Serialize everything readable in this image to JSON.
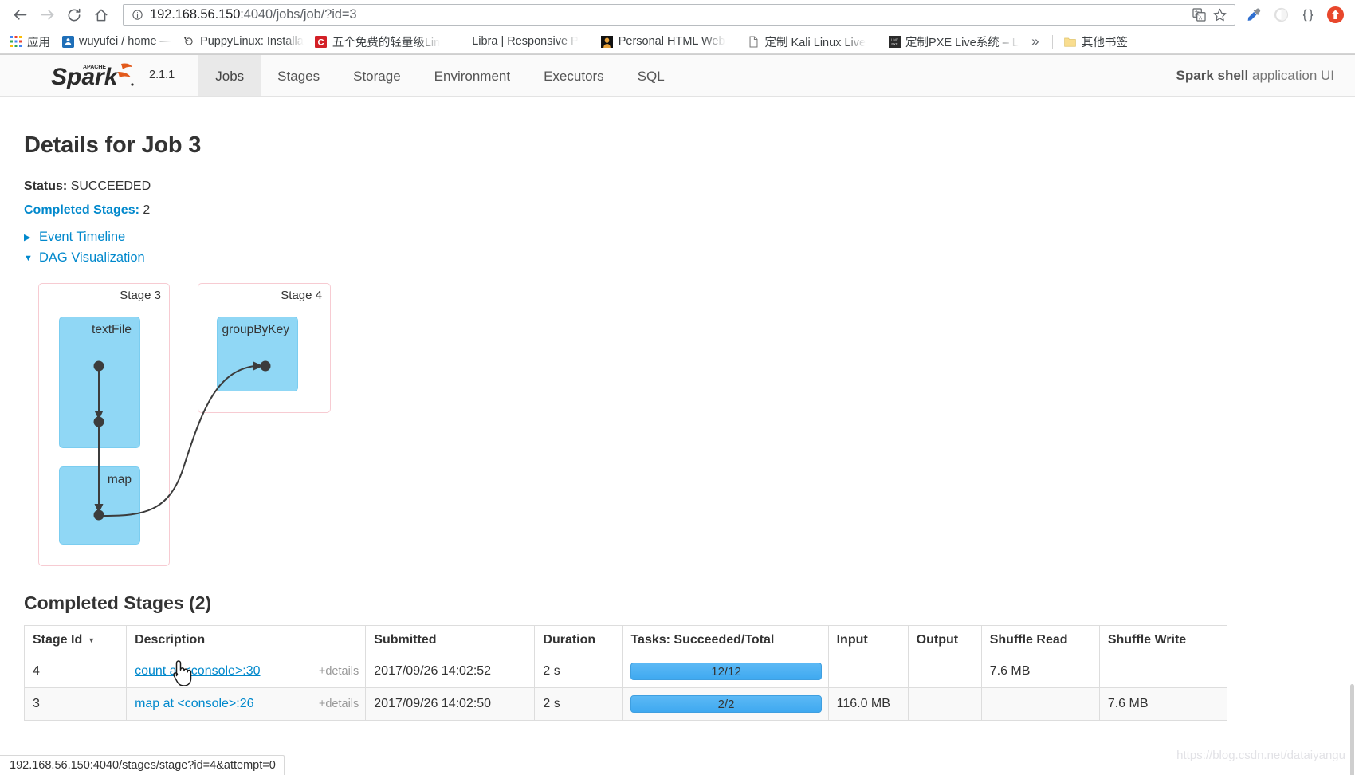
{
  "browser": {
    "nav": {
      "back_icon": "back-arrow-icon",
      "forward_icon": "forward-arrow-icon",
      "reload_icon": "reload-icon",
      "home_icon": "home-icon"
    },
    "omnibox": {
      "info_icon": "page-info-icon",
      "url_main": "192.168.56.150",
      "url_rest": ":4040/jobs/job/?id=3",
      "full_url": "192.168.56.150:4040/jobs/job/?id=3",
      "translate_icon": "translate-icon",
      "bookmark_icon": "star-icon"
    },
    "extensions": [
      {
        "name": "eyedropper-extension-icon",
        "glyph": "eyedropper"
      },
      {
        "name": "circle-extension-icon",
        "glyph": "circle"
      },
      {
        "name": "braces-extension-icon",
        "glyph": "{}"
      },
      {
        "name": "orange-arrow-extension-icon",
        "glyph": "arrow-up"
      }
    ],
    "bookmarks": {
      "apps_label": "应用",
      "items": [
        {
          "label": "wuyufei / home —",
          "icon": "github-favicon"
        },
        {
          "label": "PuppyLinux: Installa",
          "icon": "puppy-favicon"
        },
        {
          "label": "五个免费的轻量级Lin",
          "icon": "c-favicon"
        },
        {
          "label": "Libra | Responsive P",
          "icon": "generic-favicon"
        },
        {
          "label": "Personal HTML Web",
          "icon": "person-favicon"
        },
        {
          "label": "定制 Kali Linux Live",
          "icon": "doc-favicon"
        },
        {
          "label": "定制PXE Live系统 – L",
          "icon": "pxe-favicon"
        }
      ],
      "overflow_label": "»",
      "other_bookmarks_label": "其他书签",
      "other_bookmarks_icon": "folder-icon"
    }
  },
  "spark": {
    "logo_text": "Spark",
    "logo_superscript": "APACHE",
    "version": "2.1.1",
    "tabs": [
      {
        "label": "Jobs",
        "active": true
      },
      {
        "label": "Stages",
        "active": false
      },
      {
        "label": "Storage",
        "active": false
      },
      {
        "label": "Environment",
        "active": false
      },
      {
        "label": "Executors",
        "active": false
      },
      {
        "label": "SQL",
        "active": false
      }
    ],
    "app_title_bold": "Spark shell",
    "app_title_rest": " application UI"
  },
  "job": {
    "title": "Details for Job 3",
    "status_label": "Status:",
    "status_value": "SUCCEEDED",
    "completed_stages_label": "Completed Stages:",
    "completed_stages_value": "2",
    "event_timeline_label": "Event Timeline",
    "event_timeline_arrow": "▶",
    "dag_label": "DAG Visualization",
    "dag_arrow": "▼"
  },
  "dag": {
    "stages": [
      {
        "label": "Stage 3",
        "nodes": [
          {
            "label": "textFile"
          },
          {
            "label": "map"
          }
        ]
      },
      {
        "label": "Stage 4",
        "nodes": [
          {
            "label": "groupByKey"
          }
        ]
      }
    ],
    "colors": {
      "stage_border": "#f7cbd2",
      "node_fill": "#90d7f5",
      "edge": "#333333"
    }
  },
  "stages_table": {
    "heading": "Completed Stages (2)",
    "columns": [
      "Stage Id",
      "Description",
      "Submitted",
      "Duration",
      "Tasks: Succeeded/Total",
      "Input",
      "Output",
      "Shuffle Read",
      "Shuffle Write"
    ],
    "sort_column_index": 0,
    "sort_caret": "▼",
    "details_label": "+details",
    "rows": [
      {
        "stage_id": "4",
        "description": "count at <console>:30",
        "details": "+details",
        "submitted": "2017/09/26 14:02:52",
        "duration": "2 s",
        "tasks": "12/12",
        "tasks_pct": 100,
        "input": "",
        "output": "",
        "shuffle_read": "7.6 MB",
        "shuffle_write": "",
        "hovered": true
      },
      {
        "stage_id": "3",
        "description": "map at <console>:26",
        "details": "+details",
        "submitted": "2017/09/26 14:02:50",
        "duration": "2 s",
        "tasks": "2/2",
        "tasks_pct": 100,
        "input": "116.0 MB",
        "output": "",
        "shuffle_read": "",
        "shuffle_write": "7.6 MB",
        "hovered": false
      }
    ]
  },
  "status_bar": {
    "text": "192.168.56.150:4040/stages/stage?id=4&attempt=0"
  },
  "watermark": {
    "text": "https://blog.csdn.net/dataiyangu"
  },
  "colors": {
    "spark_orange": "#e25a1c",
    "link_blue": "#0088cc",
    "progress_blue": "#4aaef2",
    "node_blue": "#90d7f5",
    "stage_pink": "#f7cbd2"
  }
}
